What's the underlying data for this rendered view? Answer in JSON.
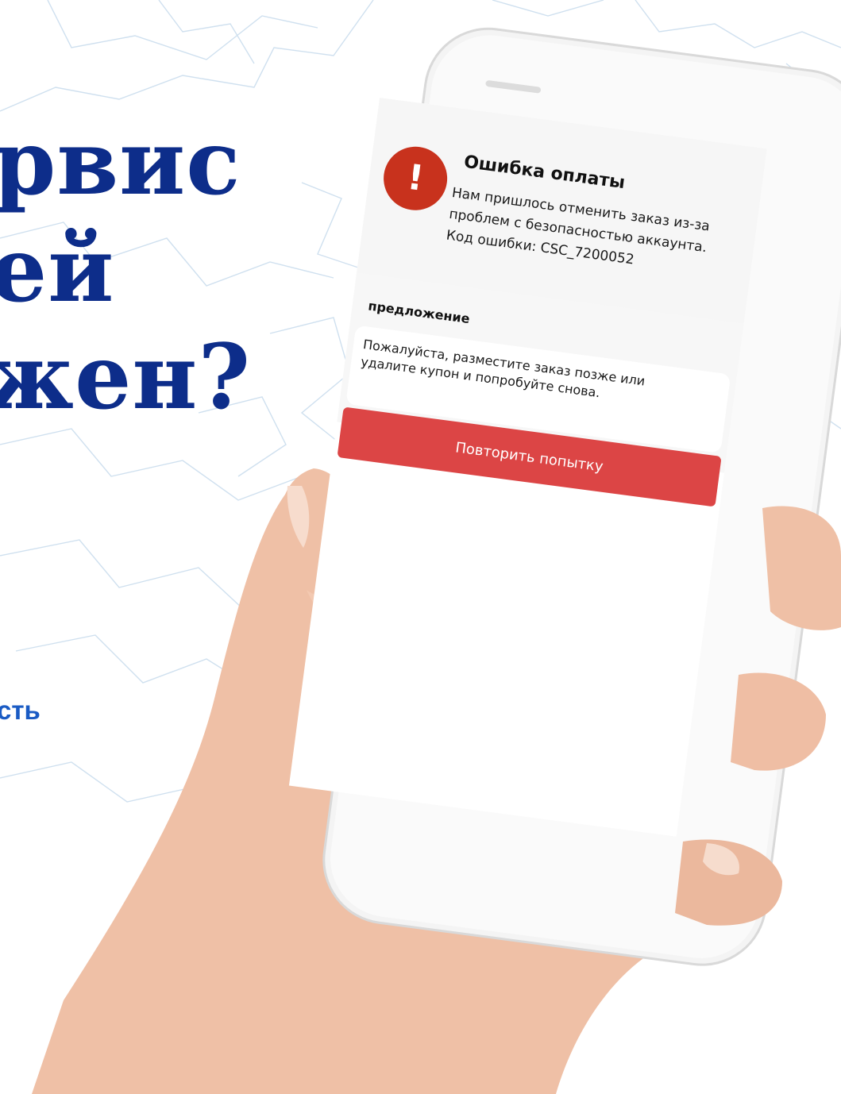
{
  "headline": {
    "line1": "рвис",
    "line2": "ей",
    "line3": "жен?"
  },
  "link_fragment": "сть",
  "phone": {
    "error": {
      "icon": "exclamation-icon",
      "icon_glyph": "!",
      "title": "Ошибка оплаты",
      "message_lines": [
        "Нам пришлось отменить заказ из-за",
        "проблем с безопасностью аккаунта.",
        "Код ошибки: CSC_7200052"
      ]
    },
    "suggestion": {
      "heading": "предложение",
      "text_lines": [
        "Пожалуйста, разместите заказ позже или",
        "удалите купон и попробуйте снова."
      ]
    },
    "retry_button_label": "Повторить попытку"
  },
  "colors": {
    "headline": "#0d2d8a",
    "link": "#1a5bc4",
    "error_icon": "#c8321d",
    "retry_button": "#dc4545"
  }
}
